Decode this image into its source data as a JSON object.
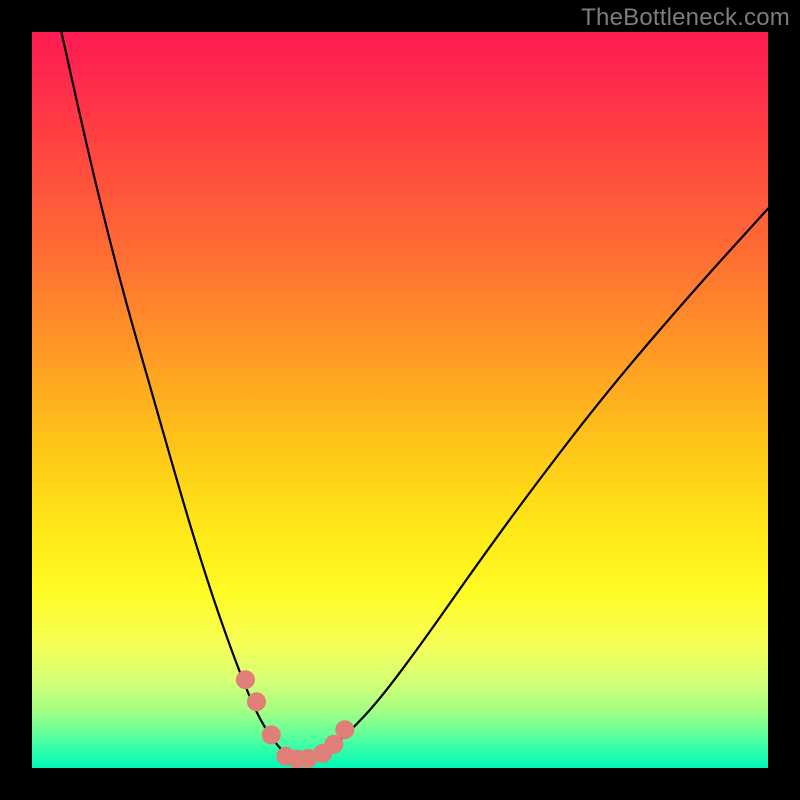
{
  "watermark": "TheBottleneck.com",
  "colors": {
    "background": "#000000",
    "gradient_top": "#ff1a52",
    "gradient_bottom": "#00f7b6",
    "curve": "#000000",
    "marker": "#e07f78"
  },
  "chart_data": {
    "type": "line",
    "title": "",
    "xlabel": "",
    "ylabel": "",
    "xlim": [
      0,
      100
    ],
    "ylim": [
      0,
      100
    ],
    "note": "Tick values and axis labels are not present in the source image; numeric values are estimated from pixel positions only.",
    "series": [
      {
        "name": "bottleneck-curve",
        "x": [
          4,
          8,
          12,
          16,
          20,
          23,
          26,
          29,
          31,
          33,
          34.5,
          36,
          38,
          40,
          43,
          47,
          53,
          60,
          68,
          78,
          90,
          100
        ],
        "y": [
          100,
          82,
          66,
          52,
          38,
          28,
          19,
          11,
          6.5,
          3.5,
          1.8,
          1.2,
          1.2,
          2.2,
          4.8,
          9,
          17,
          27,
          38,
          51,
          65,
          76
        ]
      }
    ],
    "markers": {
      "name": "highlight-points",
      "x": [
        29,
        30.5,
        32.5,
        34.5,
        36,
        37.5,
        39.5,
        41,
        42.5
      ],
      "y": [
        12,
        9,
        4.5,
        1.6,
        1.2,
        1.3,
        2,
        3.2,
        5.2
      ]
    }
  }
}
